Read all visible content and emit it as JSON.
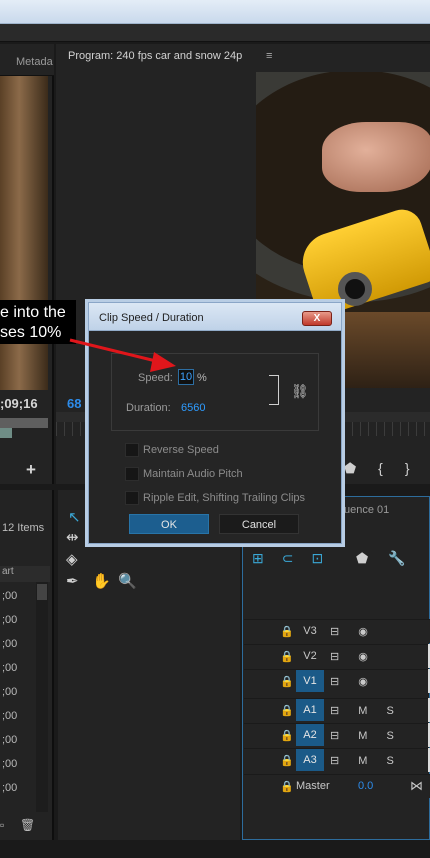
{
  "source_panel": {
    "tab_label": "Metada",
    "timecode": ";09;16"
  },
  "program_monitor": {
    "title": "Program: 240 fps car and snow 24p",
    "menu_icon": "≡",
    "timecode": "68"
  },
  "project_panel": {
    "items_count": "12 Items",
    "column_header": "art",
    "rows": [
      ";00",
      ";00",
      ";00",
      ";00",
      ";00",
      ";00",
      ";00",
      ";00",
      ";00"
    ]
  },
  "timeline": {
    "tab_label": "uence 01",
    "tracks": [
      {
        "id": "V3",
        "active": false,
        "icons": "⊟ ◉"
      },
      {
        "id": "V2",
        "active": false,
        "icons": "⊟ ◉"
      },
      {
        "id": "V1",
        "active": true,
        "icons": "⊟ ◉"
      },
      {
        "id": "A1",
        "active": true,
        "icons": "⊟ M S"
      },
      {
        "id": "A2",
        "active": true,
        "icons": "⊟ M S"
      },
      {
        "id": "A3",
        "active": true,
        "icons": "⊟ M S"
      }
    ],
    "master_label": "Master",
    "master_value": "0.0"
  },
  "callout": {
    "line1": "e into the",
    "line2": "ses 10%"
  },
  "dialog": {
    "title": "Clip Speed / Duration",
    "close_label": "X",
    "speed_label": "Speed:",
    "speed_value": "10",
    "speed_unit": "%",
    "duration_label": "Duration:",
    "duration_value": "6560",
    "options": [
      {
        "label": "Reverse Speed",
        "checked": false
      },
      {
        "label": "Maintain Audio Pitch",
        "checked": false
      },
      {
        "label": "Ripple Edit, Shifting Trailing Clips",
        "checked": false
      }
    ],
    "ok_label": "OK",
    "cancel_label": "Cancel"
  },
  "colors": {
    "accent_blue": "#2d8ceb",
    "active_track": "#1b5a88",
    "arrow_red": "#e0161b"
  }
}
